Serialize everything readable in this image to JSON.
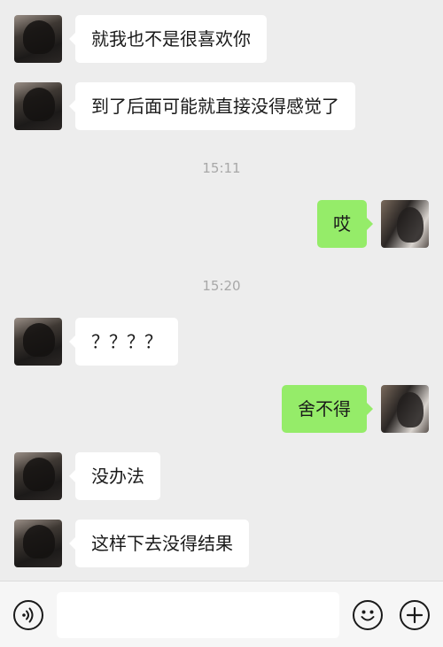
{
  "timestamps": [
    "15:11",
    "15:20"
  ],
  "messages": [
    {
      "side": "them",
      "text": "就我也不是很喜欢你"
    },
    {
      "side": "them",
      "text": "到了后面可能就直接没得感觉了"
    },
    {
      "side": "me",
      "text": "哎"
    },
    {
      "side": "them",
      "text": "？？？？"
    },
    {
      "side": "me",
      "text": "舍不得"
    },
    {
      "side": "them",
      "text": "没办法"
    },
    {
      "side": "them",
      "text": "这样下去没得结果"
    }
  ],
  "input_bar": {
    "voice_icon": "voice-icon",
    "emoji_icon": "emoji-icon",
    "more_icon": "plus-icon",
    "message_value": ""
  },
  "colors": {
    "background": "#ededed",
    "my_bubble": "#95ec69",
    "their_bubble": "#ffffff",
    "timestamp_text": "#a8a8a8"
  }
}
